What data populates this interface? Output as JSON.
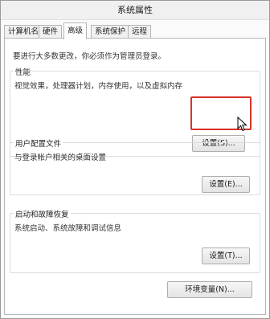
{
  "window": {
    "title": "系统属性"
  },
  "tabs": [
    {
      "label": "计算机名"
    },
    {
      "label": "硬件"
    },
    {
      "label": "高级"
    },
    {
      "label": "系统保护"
    },
    {
      "label": "远程"
    }
  ],
  "admin_note": "要进行大多数更改，你必须作为管理员登录。",
  "performance": {
    "title": "性能",
    "description": "视觉效果，处理器计划，内存使用，以及虚拟内存",
    "button": "设置(S)..."
  },
  "user_profiles": {
    "title": "用户配置文件",
    "description": "与登录帐户相关的桌面设置",
    "button": "设置(E)..."
  },
  "startup_recovery": {
    "title": "启动和故障恢复",
    "description": "系统启动、系统故障和调试信息",
    "button": "设置(T)..."
  },
  "env_button": "环境变量(N)...",
  "colors": {
    "highlight": "#d9332b"
  },
  "icons": {
    "cursor": "mouse-pointer-icon"
  }
}
